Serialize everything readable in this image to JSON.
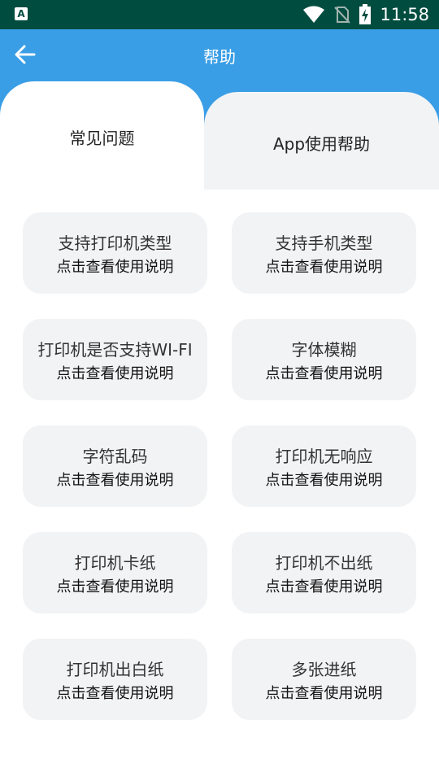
{
  "status_bar": {
    "time": "11:58",
    "icons": [
      "app-notification-icon",
      "wifi-icon",
      "no-sim-icon",
      "battery-charging-icon"
    ]
  },
  "app_bar": {
    "title": "帮助",
    "back_icon": "arrow-left-icon",
    "background": "#3a9ee6"
  },
  "tabs": [
    {
      "label": "常见问题",
      "active": true
    },
    {
      "label": "App使用帮助",
      "active": false
    }
  ],
  "cards": [
    {
      "title": "支持打印机类型",
      "subtitle": "点击查看使用说明"
    },
    {
      "title": "支持手机类型",
      "subtitle": "点击查看使用说明"
    },
    {
      "title": "打印机是否支持WI-FI",
      "subtitle": "点击查看使用说明"
    },
    {
      "title": "字体模糊",
      "subtitle": "点击查看使用说明"
    },
    {
      "title": "字符乱码",
      "subtitle": "点击查看使用说明"
    },
    {
      "title": "打印机无响应",
      "subtitle": "点击查看使用说明"
    },
    {
      "title": "打印机卡纸",
      "subtitle": "点击查看使用说明"
    },
    {
      "title": "打印机不出纸",
      "subtitle": "点击查看使用说明"
    },
    {
      "title": "打印机出白纸",
      "subtitle": "点击查看使用说明"
    },
    {
      "title": "多张进纸",
      "subtitle": "点击查看使用说明"
    }
  ]
}
